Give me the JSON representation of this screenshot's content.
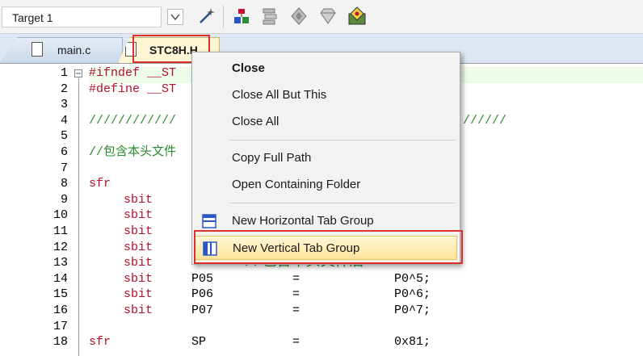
{
  "toolbar": {
    "target_value": "Target 1",
    "icons": [
      "target-dropdown-icon",
      "magic-wand-icon",
      "options-icon",
      "layers-icon",
      "diamond-icon",
      "gem-icon",
      "pack-icon"
    ]
  },
  "tabs": [
    {
      "label": "main.c",
      "active": false
    },
    {
      "label": "STC8H.H",
      "active": true
    }
  ],
  "editor": {
    "lines": [
      {
        "n": "1",
        "code": "#ifndef __ST"
      },
      {
        "n": "2",
        "code": "#define __ST"
      },
      {
        "n": "3",
        "code": ""
      },
      {
        "n": "4",
        "code": "////////////"
      },
      {
        "n": "5",
        "code": ""
      },
      {
        "n": "6",
        "code": "//包含本头文件"
      },
      {
        "n": "7",
        "code": ""
      },
      {
        "n": "8",
        "kw": "sfr",
        "code": ""
      },
      {
        "n": "9",
        "kw": "sbit",
        "code": ""
      },
      {
        "n": "10",
        "kw": "sbit",
        "code": ""
      },
      {
        "n": "11",
        "kw": "sbit",
        "code": ""
      },
      {
        "n": "12",
        "kw": "sbit",
        "code": ""
      },
      {
        "n": "13",
        "kw": "sbit",
        "code": ""
      },
      {
        "n": "14",
        "kw": "sbit",
        "name": "P05",
        "eq": "=",
        "val": "P0^5;"
      },
      {
        "n": "15",
        "kw": "sbit",
        "name": "P06",
        "eq": "=",
        "val": "P0^6;"
      },
      {
        "n": "16",
        "kw": "sbit",
        "name": "P07",
        "eq": "=",
        "val": "P0^7;"
      },
      {
        "n": "17",
        "code": ""
      },
      {
        "n": "18",
        "kw": "sfr",
        "name": "SP",
        "eq": "=",
        "val": "0x81;"
      }
    ],
    "line4_tail": "//////",
    "line13_comment": "//包含本头文件后"
  },
  "context_menu": {
    "items": [
      {
        "label": "Close",
        "bold": true
      },
      {
        "label": "Close All But This"
      },
      {
        "label": "Close All"
      },
      {
        "label": "Copy Full Path"
      },
      {
        "label": "Open Containing Folder"
      },
      {
        "label": "New Horizontal Tab Group",
        "icon": "horizontal-tab-group-icon"
      },
      {
        "label": "New Vertical Tab Group",
        "icon": "vertical-tab-group-icon",
        "hover": true
      }
    ]
  },
  "colors": {
    "highlight": "#e0302e",
    "keyword": "#b2102a",
    "comment": "#2b8a2b",
    "menu_hover": "#ffe49a"
  }
}
